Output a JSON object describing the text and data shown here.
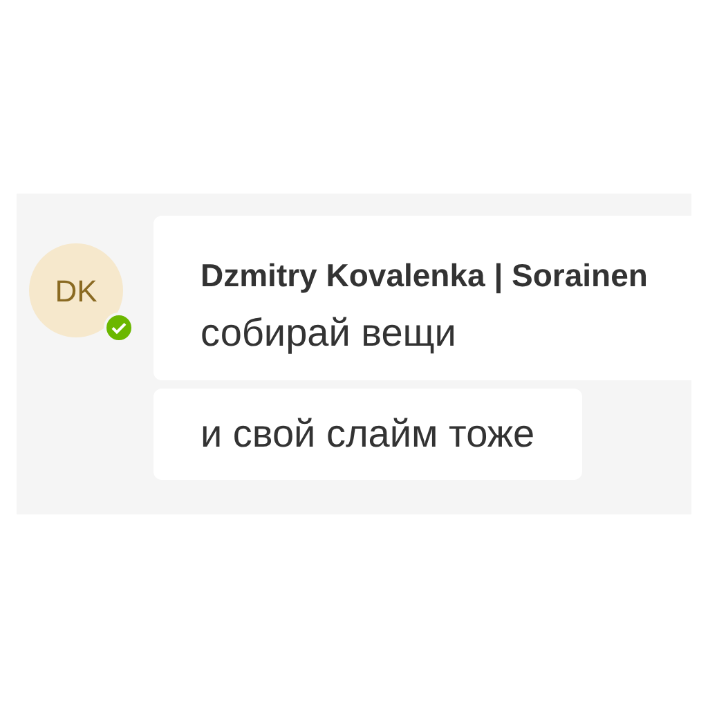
{
  "sender": {
    "initials": "DK",
    "name": "Dzmitry Kovalenka | Sorainen",
    "online": true
  },
  "messages": [
    {
      "text": "собирай вещи"
    },
    {
      "text": "и свой слайм тоже"
    }
  ]
}
